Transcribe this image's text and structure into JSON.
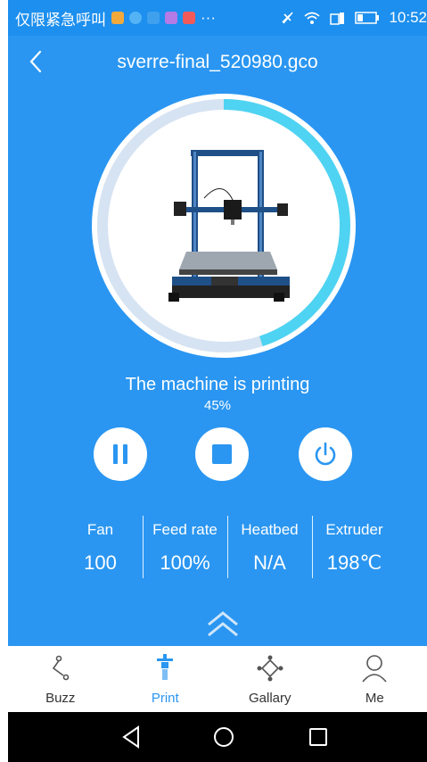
{
  "status_bar": {
    "carrier_text": "仅限紧急呼叫",
    "more_dots": "···",
    "time": "10:52",
    "icons": [
      "app-icon-1",
      "app-icon-2",
      "app-icon-3",
      "app-icon-4",
      "app-icon-5",
      "mute-icon",
      "wifi-icon",
      "signal-icon",
      "battery-icon"
    ]
  },
  "header": {
    "file_name": "sverre-final_520980.gco"
  },
  "progress": {
    "percent_text": "45%",
    "fraction": 0.45
  },
  "machine_status": "The machine is printing",
  "controls": {
    "pause": "pause-icon",
    "stop": "stop-icon",
    "power": "power-icon"
  },
  "stats": [
    {
      "label": "Fan",
      "value": "100"
    },
    {
      "label": "Feed rate",
      "value": "100%"
    },
    {
      "label": "Heatbed",
      "value": "N/A"
    },
    {
      "label": "Extruder",
      "value": "198℃"
    }
  ],
  "tabs": [
    {
      "label": "Buzz",
      "icon": "buzz-icon",
      "active": false
    },
    {
      "label": "Print",
      "icon": "print-icon",
      "active": true
    },
    {
      "label": "Gallary",
      "icon": "gallery-icon",
      "active": false
    },
    {
      "label": "Me",
      "icon": "profile-icon",
      "active": false
    }
  ],
  "colors": {
    "primary_blue": "#2a96f1",
    "status_bar_blue": "#1d8fee",
    "progress_cyan": "#4fd3f2",
    "track": "#d6e3f2",
    "tab_inactive": "#555555",
    "tab_active": "#2a96f1"
  }
}
